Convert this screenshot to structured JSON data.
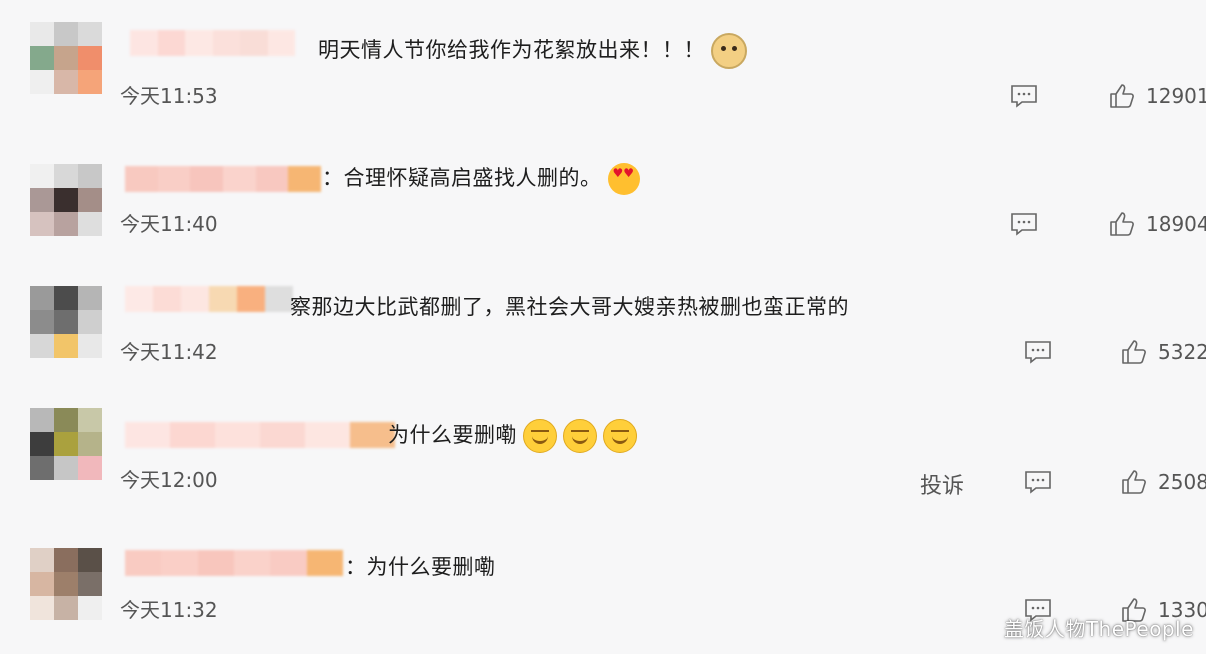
{
  "comments": [
    {
      "text": "明天情人节你给我作为花絮放出来！！！",
      "emojis": [
        "doge-emoji"
      ],
      "time": "今天11:53",
      "likes": "12901",
      "avatar_colors": [
        "#e9e9e9",
        "#c8c8c8",
        "#dadada",
        "#84a98c",
        "#c6a48c",
        "#f08e6b",
        "#efefef",
        "#d8b7a8",
        "#f5a479"
      ],
      "name_colors": [
        "#fde5e2",
        "#fcd8d3",
        "#fde8e4",
        "#fbe0db",
        "#f9ddd7",
        "#fde7e3"
      ]
    },
    {
      "text": "：合理怀疑高启盛找人删的。",
      "emojis": [
        "heart-eyes-emoji"
      ],
      "time": "今天11:40",
      "likes": "18904",
      "avatar_colors": [
        "#f0f0f0",
        "#d8d8d8",
        "#c8c8c8",
        "#aa9896",
        "#3a2f2e",
        "#a48e88",
        "#d6c2bf",
        "#b8a29f",
        "#dedede"
      ],
      "name_colors": [
        "#f8c9c0",
        "#f9cec6",
        "#f7c5bd",
        "#fad3cc",
        "#f8c8c0",
        "#f6b673"
      ]
    },
    {
      "text": "察那边大比武都删了，黑社会大哥大嫂亲热被删也蛮正常的",
      "emojis": [],
      "time": "今天11:42",
      "likes": "5322",
      "avatar_colors": [
        "#9a9a9a",
        "#4c4c4c",
        "#b5b5b5",
        "#8c8c8c",
        "#6e6e6e",
        "#cfcfcf",
        "#d7d7d7",
        "#f2c569",
        "#e8e8e8"
      ],
      "name_colors": [
        "#fde9e6",
        "#fcdcd6",
        "#fde6e1",
        "#f7d9b2",
        "#f9b07f",
        "#dedede"
      ]
    },
    {
      "text": "为什么要删嘞",
      "emojis": [
        "squint-emoji",
        "squint-emoji",
        "squint-emoji"
      ],
      "time": "今天12:00",
      "likes": "2508",
      "report": "投诉",
      "avatar_colors": [
        "#b8b8b8",
        "#8a8a58",
        "#c8c8a8",
        "#3d3d3d",
        "#aaa13e",
        "#b5b38a",
        "#6e6e6e",
        "#c6c6c6",
        "#f1b8bc"
      ],
      "name_colors": [
        "#fde5e2",
        "#fcd7d1",
        "#fde1dc",
        "#fbd8d2",
        "#fde6e1",
        "#f6be8c"
      ]
    },
    {
      "text": "：为什么要删嘞",
      "emojis": [],
      "time": "今天11:32",
      "likes": "1330",
      "avatar_colors": [
        "#e0d0c6",
        "#8a6e5e",
        "#5a5048",
        "#d7b6a2",
        "#9d7f6a",
        "#7a6f68",
        "#f0e4dc",
        "#c7b2a5",
        "#efefef"
      ],
      "name_colors": [
        "#f9cbc2",
        "#facfc7",
        "#f8c6bd",
        "#fad2ca",
        "#f9cbc3",
        "#f6b673"
      ]
    }
  ],
  "watermark": "盖饭人物ThePeople"
}
